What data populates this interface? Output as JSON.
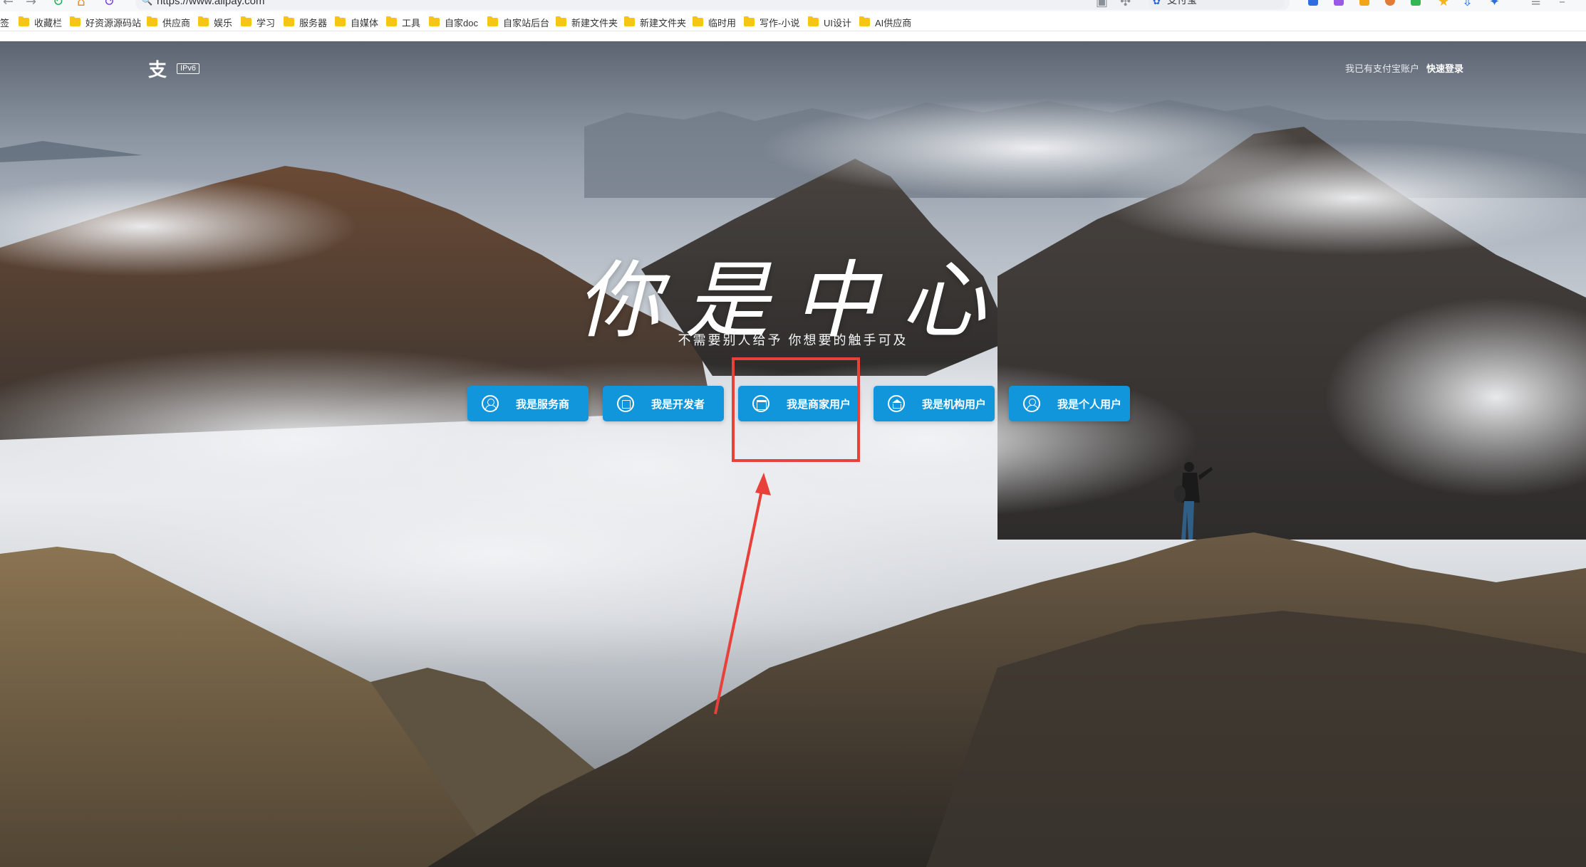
{
  "browser": {
    "url": "https://www.alipay.com",
    "search_engine_label": "支付宝",
    "bookmarks": [
      "收藏栏",
      "好资源源码站",
      "供应商",
      "娱乐",
      "学习",
      "服务器",
      "自媒体",
      "工具",
      "自家doc",
      "自家站后台",
      "新建文件夹",
      "新建文件夹",
      "临时用",
      "写作-小说",
      "UI设计",
      "AI供应商"
    ],
    "bookmark_prefix": "签"
  },
  "header": {
    "logo_text": "支",
    "ipv6_label": "IPv6",
    "account_prompt": "我已有支付宝账户",
    "login_link": "快速登录"
  },
  "hero": {
    "slogan": "你是中心",
    "subtitle": "不需要别人给予  你想要的触手可及"
  },
  "roles": [
    {
      "label": "我是服务商",
      "icon": "person-circle-icon"
    },
    {
      "label": "我是开发者",
      "icon": "document-icon"
    },
    {
      "label": "我是商家用户",
      "icon": "shop-icon"
    },
    {
      "label": "我是机构用户",
      "icon": "bank-icon"
    },
    {
      "label": "我是个人用户",
      "icon": "person-circle-icon"
    }
  ],
  "annotation": {
    "highlighted_role": "我是商家用户",
    "color": "#e8403a"
  },
  "colors": {
    "button_bg": "#1296db",
    "bookmark_folder": "#f5c518"
  }
}
